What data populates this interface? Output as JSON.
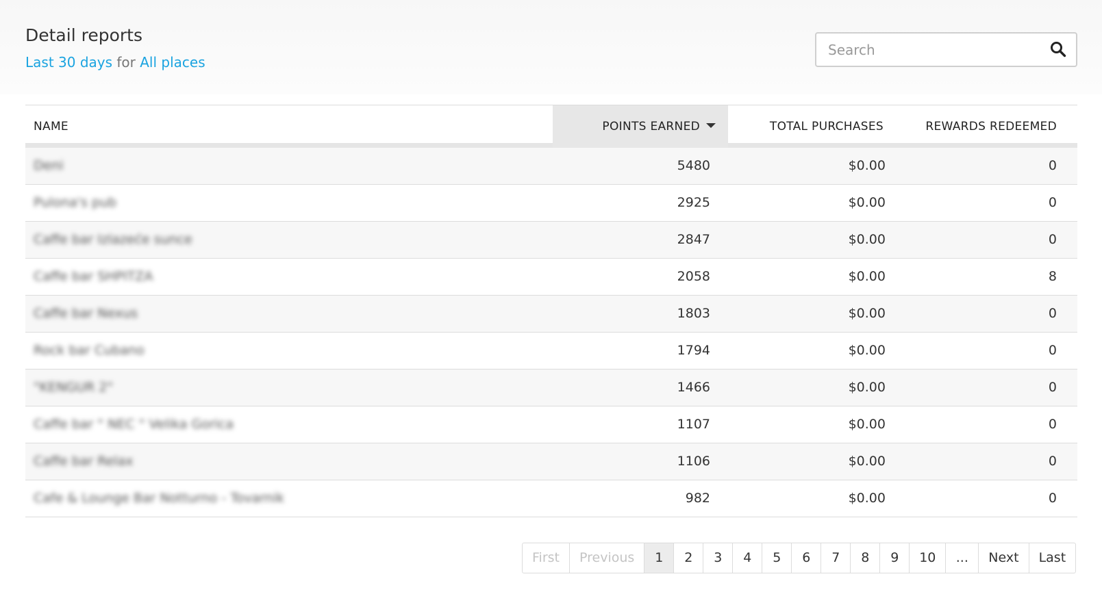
{
  "header": {
    "title": "Detail reports",
    "period_link": "Last 30 days",
    "for_text": "for",
    "places_link": "All places"
  },
  "search": {
    "placeholder": "Search"
  },
  "table": {
    "columns": [
      "NAME",
      "POINTS EARNED",
      "TOTAL PURCHASES",
      "REWARDS REDEEMED"
    ],
    "sort_column": "POINTS EARNED",
    "sort_direction": "descending",
    "rows": [
      {
        "name": "Deni",
        "points": "5480",
        "purchases": "$0.00",
        "rewards": "0"
      },
      {
        "name": "Pulona's pub",
        "points": "2925",
        "purchases": "$0.00",
        "rewards": "0"
      },
      {
        "name": "Caffe bar Izlazeće sunce",
        "points": "2847",
        "purchases": "$0.00",
        "rewards": "0"
      },
      {
        "name": "Caffe bar SHPITZA",
        "points": "2058",
        "purchases": "$0.00",
        "rewards": "8"
      },
      {
        "name": "Caffe bar Nexus",
        "points": "1803",
        "purchases": "$0.00",
        "rewards": "0"
      },
      {
        "name": "Rock bar Cubano",
        "points": "1794",
        "purchases": "$0.00",
        "rewards": "0"
      },
      {
        "name": "\"KENGUR 2\"",
        "points": "1466",
        "purchases": "$0.00",
        "rewards": "0"
      },
      {
        "name": "Caffe bar \" NEC \" Velika Gorica",
        "points": "1107",
        "purchases": "$0.00",
        "rewards": "0"
      },
      {
        "name": "Caffe bar Relax",
        "points": "1106",
        "purchases": "$0.00",
        "rewards": "0"
      },
      {
        "name": "Cafe & Lounge Bar Notturno - Tovarnik",
        "points": "982",
        "purchases": "$0.00",
        "rewards": "0"
      }
    ]
  },
  "pagination": {
    "first": "First",
    "previous": "Previous",
    "pages": [
      "1",
      "2",
      "3",
      "4",
      "5",
      "6",
      "7",
      "8",
      "9",
      "10"
    ],
    "current_page": "1",
    "ellipsis": "...",
    "next": "Next",
    "last": "Last"
  },
  "colors": {
    "link": "#1aa3e0",
    "sorted_header_bg": "#e7e7e7",
    "row_stripe": "#f7f7f7"
  },
  "icons": {
    "search": "search-icon",
    "sort": "caret-down-icon"
  }
}
